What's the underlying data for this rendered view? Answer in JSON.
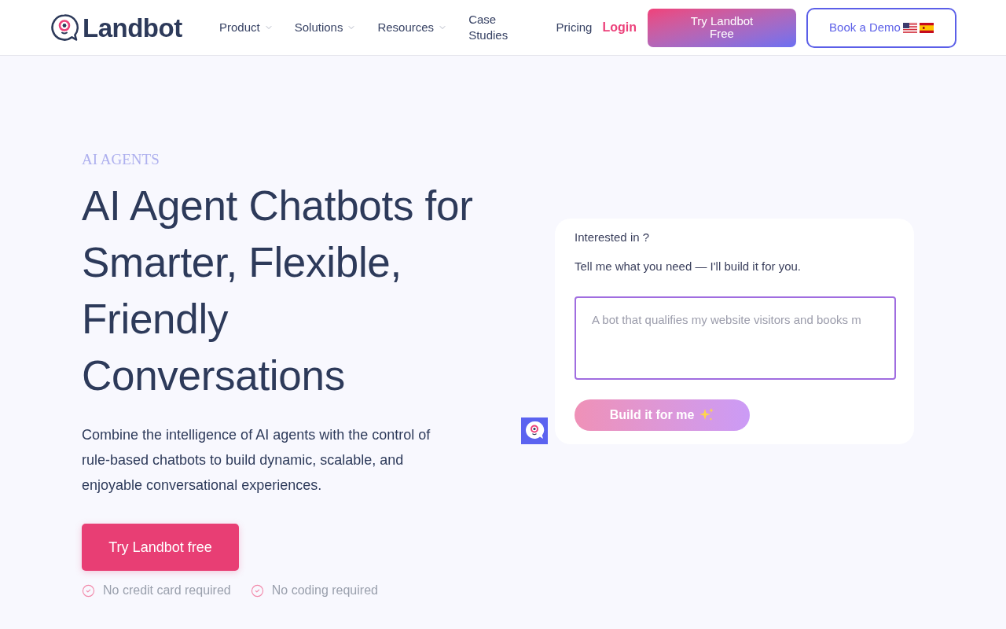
{
  "header": {
    "logo": {
      "text": "Landbot"
    },
    "nav": [
      {
        "label": "Product",
        "kind": "menu"
      },
      {
        "label": "Solutions",
        "kind": "menu"
      },
      {
        "label": "Resources",
        "kind": "menu"
      },
      {
        "label": "Case Studies",
        "kind": "link"
      },
      {
        "label": "Pricing",
        "kind": "link"
      }
    ],
    "login": {
      "label": "Login"
    },
    "try_button": {
      "label": "Try Landbot Free"
    },
    "demo_button": {
      "label": "Book a Demo"
    }
  },
  "hero": {
    "eyebrow": "AI AGENTS",
    "title_lines": [
      "AI Agent Chatbots for",
      "Smarter, Flexible,",
      "Friendly",
      "Conversations"
    ],
    "description_lines": [
      "Combine the intelligence of AI agents with the control of",
      "rule-based chatbots to build dynamic, scalable, and",
      "enjoyable conversational experiences."
    ],
    "cta": {
      "label": "Try Landbot free"
    },
    "perks": [
      "No credit card required",
      "No coding required"
    ]
  },
  "chat_widget": {
    "messages": [
      "Interested in ?",
      "Tell me what you need — I'll build it for you."
    ],
    "input": {
      "placeholder": "A bot that qualifies my website visitors and books m"
    },
    "submit": {
      "label": "Build it for me"
    }
  }
}
